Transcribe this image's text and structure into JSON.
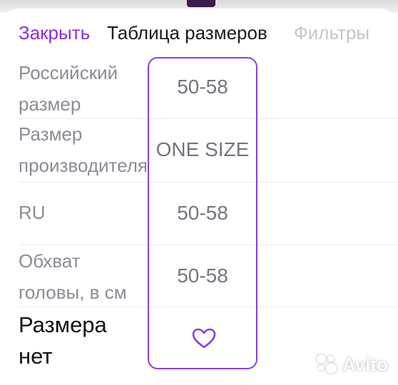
{
  "header": {
    "close_label": "Закрыть",
    "title": "Таблица размеров",
    "filters_label": "Фильтры"
  },
  "rows": [
    {
      "label_line1": "Российский",
      "label_line2": "размер",
      "value": "50-58"
    },
    {
      "label_line1": "Размер",
      "label_line2": "производителя",
      "value": "ONE SIZE"
    },
    {
      "label_line1": "RU",
      "value": "50-58"
    },
    {
      "label_line1": "Обхват",
      "label_line2": "головы, в см",
      "value": "50-58"
    }
  ],
  "footer": {
    "label_line1": "Размера",
    "label_line2": "нет",
    "icon": "heart-outline-icon"
  },
  "watermark": {
    "text": "Avito"
  },
  "colors": {
    "accent": "#8a2be2",
    "highlight_border": "#8a3fe0",
    "muted_text": "#8e8a94",
    "value_text": "#77737d"
  }
}
